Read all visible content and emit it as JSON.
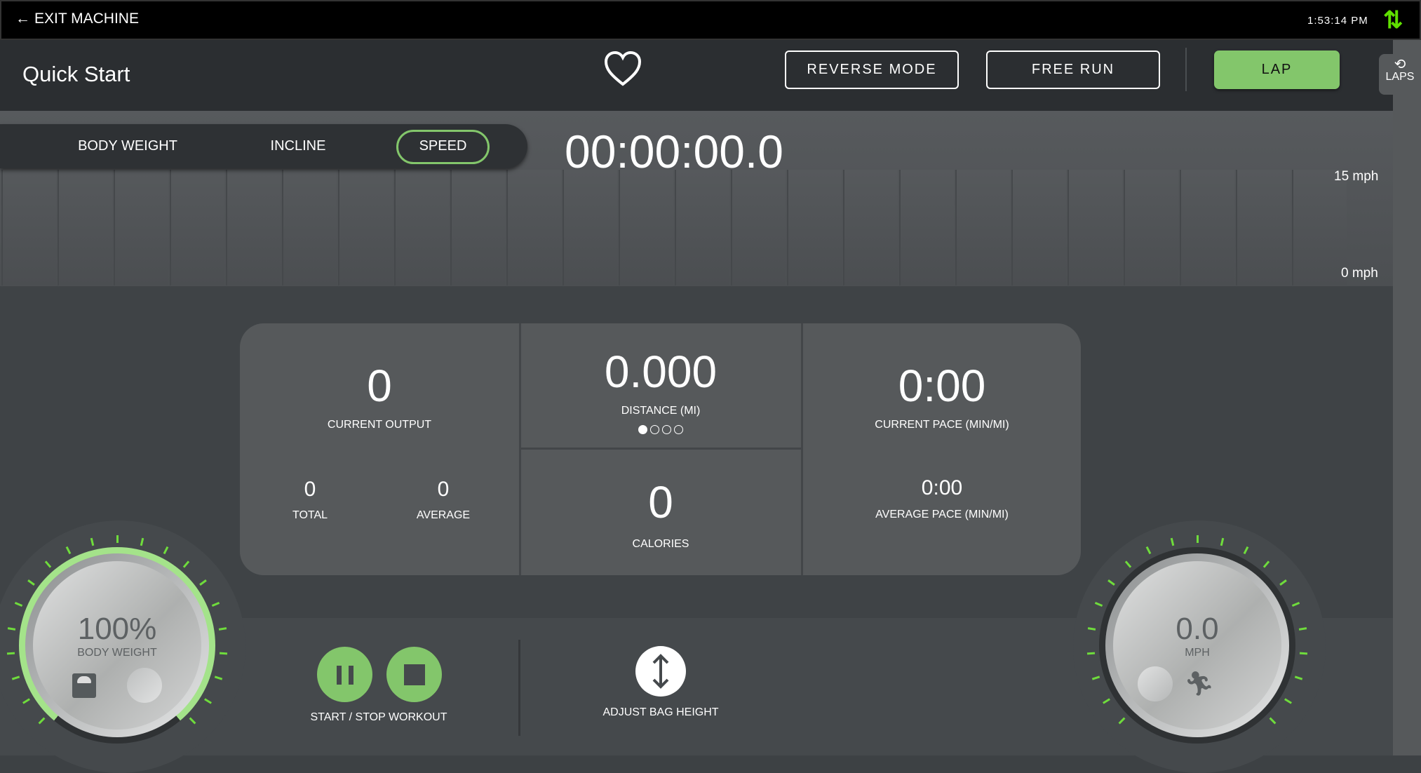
{
  "topbar": {
    "exit_label": "EXIT MACHINE",
    "time": "1:53:14 PM",
    "sync_icon": "up-down-arrows",
    "sync_color": "#5fe000"
  },
  "header": {
    "title": "Quick Start",
    "heart_icon": "heart",
    "reverse_label": "REVERSE MODE",
    "free_run_label": "FREE RUN",
    "lap_label": "LAP",
    "laps_tab_label": "LAPS",
    "accent": "#83c66b"
  },
  "toggle": {
    "items": [
      "BODY WEIGHT",
      "INCLINE",
      "SPEED"
    ],
    "selected": "SPEED"
  },
  "timer": "00:00:00.0",
  "graph": {
    "max_label": "15 mph",
    "min_label": "0 mph"
  },
  "stats": {
    "current_output": {
      "value": "0",
      "label": "CURRENT OUTPUT"
    },
    "total": {
      "value": "0",
      "label": "TOTAL"
    },
    "average": {
      "value": "0",
      "label": "AVERAGE"
    },
    "distance": {
      "value": "0.000",
      "label": "DISTANCE (MI)",
      "page": 1,
      "pages": 4
    },
    "calories": {
      "value": "0",
      "label": "CALORIES"
    },
    "current_pace": {
      "value": "0:00",
      "label": "CURRENT PACE (MIN/MI)"
    },
    "average_pace": {
      "value": "0:00",
      "label": "AVERAGE PACE (MIN/MI)"
    }
  },
  "body_weight_dial": {
    "value": "100%",
    "label": "BODY WEIGHT",
    "icon": "scale",
    "level_percent": 100
  },
  "speed_dial": {
    "value": "0.0",
    "label": "MPH",
    "icon": "runner",
    "level_percent": 0
  },
  "controls": {
    "start_stop_label": "START / STOP WORKOUT",
    "adjust_bag_label": "ADJUST BAG HEIGHT"
  }
}
